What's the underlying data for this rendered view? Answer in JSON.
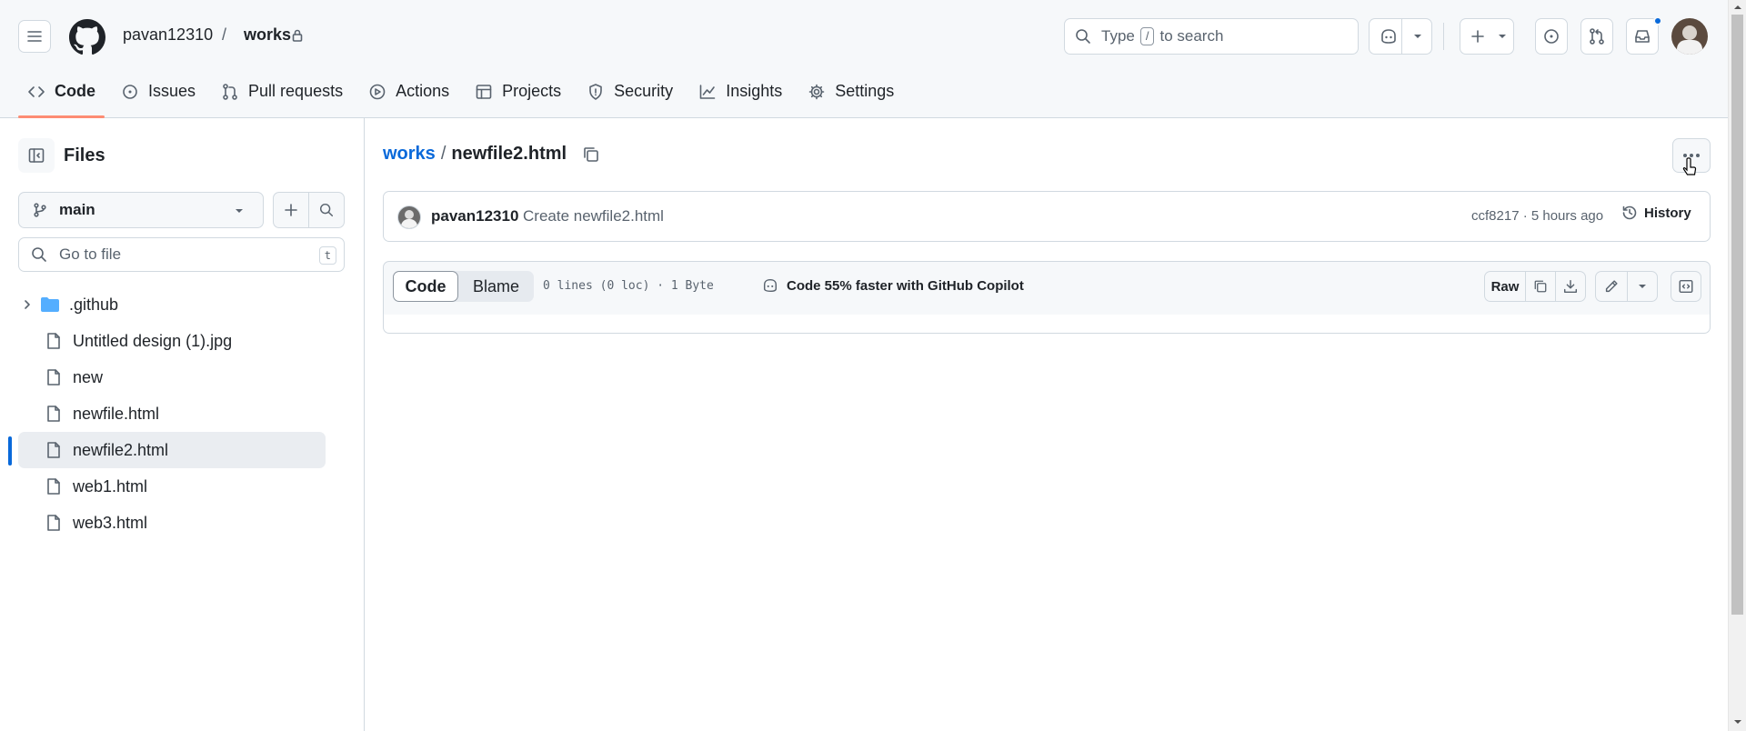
{
  "header": {
    "owner": "pavan12310",
    "separator": "/",
    "repo": "works",
    "search_label": "Type",
    "search_key": "/",
    "search_suffix": "to search"
  },
  "nav": [
    {
      "label": "Code",
      "icon": "code-icon"
    },
    {
      "label": "Issues",
      "icon": "issue-icon"
    },
    {
      "label": "Pull requests",
      "icon": "pull-request-icon"
    },
    {
      "label": "Actions",
      "icon": "play-icon"
    },
    {
      "label": "Projects",
      "icon": "table-icon"
    },
    {
      "label": "Security",
      "icon": "shield-icon"
    },
    {
      "label": "Insights",
      "icon": "graph-icon"
    },
    {
      "label": "Settings",
      "icon": "gear-icon"
    }
  ],
  "sidebar": {
    "title": "Files",
    "branch": "main",
    "goto_placeholder": "Go to file",
    "goto_shortcut": "t",
    "tree": [
      {
        "name": ".github",
        "type": "folder"
      },
      {
        "name": "Untitled design (1).jpg",
        "type": "file"
      },
      {
        "name": "new",
        "type": "file"
      },
      {
        "name": "newfile.html",
        "type": "file"
      },
      {
        "name": "newfile2.html",
        "type": "file",
        "selected": true
      },
      {
        "name": "web1.html",
        "type": "file"
      },
      {
        "name": "web3.html",
        "type": "file"
      }
    ]
  },
  "file": {
    "repo_link": "works",
    "separator": "/",
    "name": "newfile2.html"
  },
  "commit": {
    "author": "pavan12310",
    "message": "Create newfile2.html",
    "meta": "ccf8217 · 5 hours ago",
    "history_label": "History"
  },
  "toolbar": {
    "code_tab": "Code",
    "blame_tab": "Blame",
    "stats": "0 lines (0 loc) · 1 Byte",
    "copilot": "Code 55% faster with GitHub Copilot",
    "raw": "Raw"
  },
  "colors": {
    "accent_underline": "#fd8c73",
    "link": "#0969da",
    "notification_dot": "#0969da",
    "selected_marker": "#0969da"
  }
}
